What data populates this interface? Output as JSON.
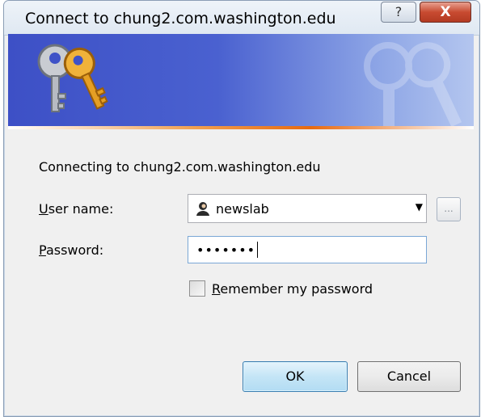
{
  "window": {
    "title": "Connect to chung2.com.washington.edu",
    "help_label": "?",
    "close_label": "X"
  },
  "dialog": {
    "connecting_text": "Connecting to chung2.com.washington.edu",
    "username_label": "User name:",
    "username_label_mnemonic": "U",
    "username_label_rest": "ser name:",
    "username_value": "newslab",
    "browse_label": "...",
    "password_label_mnemonic": "P",
    "password_label_rest": "assword:",
    "password_value": "•••••••",
    "remember_mnemonic": "R",
    "remember_rest": "emember my password",
    "remember_checked": false,
    "ok_label": "OK",
    "cancel_label": "Cancel"
  },
  "colors": {
    "banner_start": "#3d50c6",
    "banner_end": "#b4c6ef",
    "accent_orange": "#e86a10",
    "close_red": "#c84b31"
  },
  "icons": {
    "banner": "keys-icon",
    "user": "user-icon",
    "dropdown": "chevron-down-icon"
  }
}
